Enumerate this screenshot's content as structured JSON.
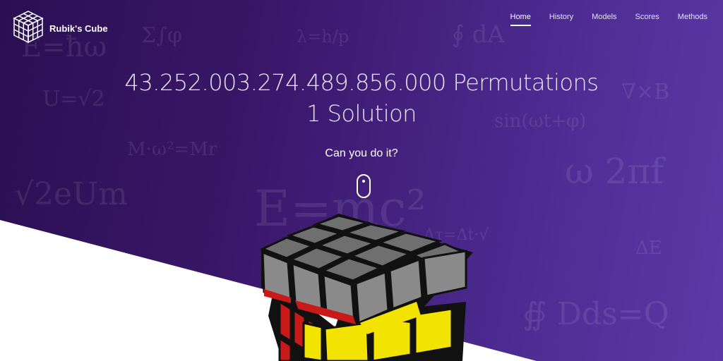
{
  "brand": {
    "name": "Rubik's Cube",
    "logo_icon": "cube-logo-icon"
  },
  "nav": {
    "items": [
      {
        "label": "Home",
        "active": true
      },
      {
        "label": "History",
        "active": false
      },
      {
        "label": "Models",
        "active": false
      },
      {
        "label": "Scores",
        "active": false
      },
      {
        "label": "Methods",
        "active": false
      }
    ]
  },
  "hero": {
    "line1": "43.252.003.274.489.856.000 Permutations",
    "line2": "1 Solution",
    "tagline": "Can you do it?",
    "scroll_icon": "mouse-scroll-icon"
  },
  "colors": {
    "gradient_start": "#2a0f52",
    "gradient_end": "#5b3aa8",
    "text": "#ffffff"
  }
}
